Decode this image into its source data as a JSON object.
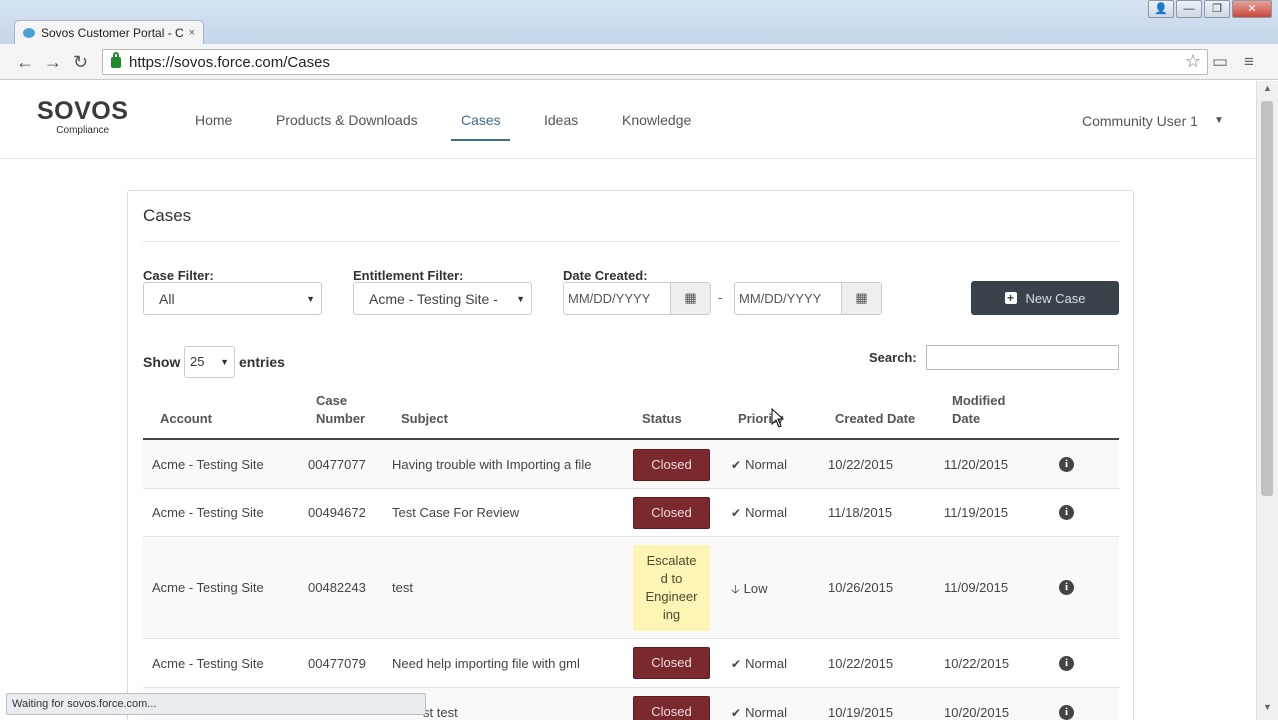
{
  "browser": {
    "tab_title": "Sovos Customer Portal - C",
    "tab_close": "×",
    "url": "https://sovos.force.com/Cases",
    "window_controls": [
      "👤",
      "—",
      "❐",
      "✕"
    ]
  },
  "site": {
    "logo_main": "SOVOS",
    "logo_sub": "Compliance",
    "nav": [
      "Home",
      "Products & Downloads",
      "Cases",
      "Ideas",
      "Knowledge"
    ],
    "active_nav": "Cases",
    "user": "Community User 1"
  },
  "panel": {
    "title": "Cases",
    "case_filter_label": "Case Filter:",
    "case_filter_value": "All",
    "entitlement_filter_label": "Entitlement Filter:",
    "entitlement_filter_value": "Acme - Testing Site -",
    "date_created_label": "Date Created:",
    "date_from_placeholder": "MM/DD/YYYY",
    "date_to_placeholder": "MM/DD/YYYY",
    "date_separator": "-",
    "new_case_label": "New Case",
    "show_label": "Show",
    "entries_value": "25",
    "entries_label": "entries",
    "search_label": "Search:"
  },
  "table": {
    "headers": {
      "account": "Account",
      "case_number_1": "Case",
      "case_number_2": "Number",
      "subject": "Subject",
      "status": "Status",
      "priority": "Priority",
      "created": "Created Date",
      "modified_1": "Modified",
      "modified_2": "Date"
    },
    "rows": [
      {
        "account": "Acme - Testing Site",
        "case_number": "00477077",
        "subject": "Having trouble with Importing a file",
        "status": "Closed",
        "priority": "Normal",
        "created": "10/22/2015",
        "modified": "11/20/2015"
      },
      {
        "account": "Acme - Testing Site",
        "case_number": "00494672",
        "subject": "Test Case For Review",
        "status": "Closed",
        "priority": "Normal",
        "created": "11/18/2015",
        "modified": "11/19/2015"
      },
      {
        "account": "Acme - Testing Site",
        "case_number": "00482243",
        "subject": "test",
        "status_lines": [
          "Escalate",
          "d to",
          "Engineer",
          "ing"
        ],
        "priority": "Low",
        "created": "10/26/2015",
        "modified": "11/09/2015"
      },
      {
        "account": "Acme - Testing Site",
        "case_number": "00477079",
        "subject": "Need help importing file with gml",
        "status": "Closed",
        "priority": "Normal",
        "created": "10/22/2015",
        "modified": "10/22/2015"
      },
      {
        "account": "",
        "case_number": "",
        "subject": "st test",
        "status": "Closed",
        "priority": "Normal",
        "created": "10/19/2015",
        "modified": "10/20/2015"
      }
    ]
  },
  "status_bar": "Waiting for sovos.force.com..."
}
